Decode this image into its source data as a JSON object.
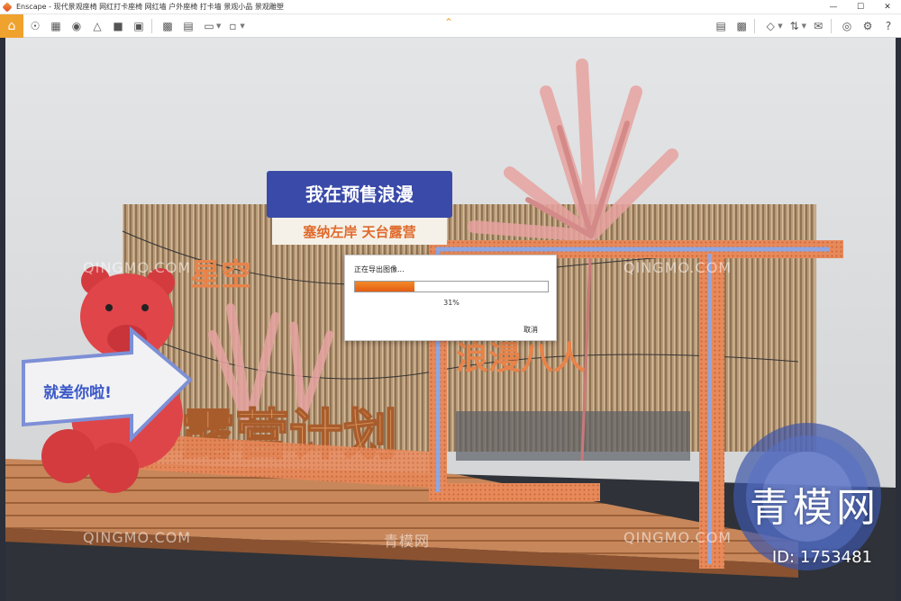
{
  "window": {
    "title": "Enscape - 现代景观座椅 网红打卡座椅 网红墙 户外座椅 打卡墙 景观小品 景观雕塑",
    "controls": [
      "minimize",
      "maximize",
      "close"
    ]
  },
  "toolbar": {
    "left_icons": [
      "home-icon",
      "paint-icon",
      "grid-icon",
      "binoculars-icon",
      "view-icon",
      "asset-icon",
      "clapper-icon",
      "screenshot-icon",
      "batch-render-icon",
      "panorama-icon",
      "export-icon"
    ],
    "right_icons": [
      "map-icon",
      "preview-icon",
      "cube-icon",
      "sync-icon",
      "chat-icon",
      "eye-icon",
      "settings-icon"
    ],
    "accent": "#f0a22f"
  },
  "scene": {
    "sign_top": "我在预售浪漫",
    "sign_sub": "塞纳左岸 天台露营",
    "arrow_sign": "就差你啦!",
    "big_letters": "露营计划",
    "wall_text_left": "星空",
    "wall_text_right": "浪漫八人"
  },
  "watermarks": {
    "site": "QINGMO.COM",
    "site_cn": "青模网",
    "brand": "青模网",
    "id": "ID: 1753481"
  },
  "dialog": {
    "title": "正在导出图像...",
    "progress": 0.31,
    "percent_label": "31%",
    "cancel_label": "取消"
  }
}
